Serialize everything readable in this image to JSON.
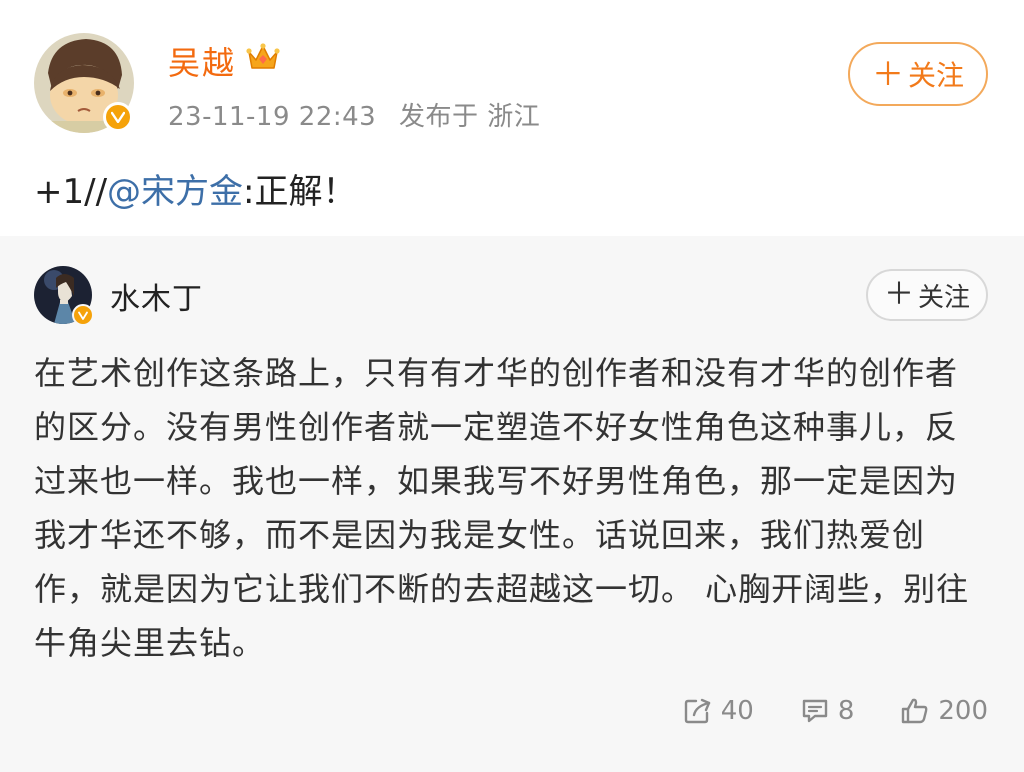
{
  "post": {
    "author": "吴越",
    "timestamp": "23-11-19 22:43",
    "location": "发布于 浙江",
    "follow_label": "关注",
    "text_prefix": "+1//",
    "mention": "@宋方金",
    "text_suffix": ":正解！",
    "icons": {
      "crown": "crown-icon",
      "verified": "verified-badge-icon",
      "plus": "plus-icon"
    },
    "colors": {
      "author": "#f36a0f",
      "follow": "#f27a1a",
      "mention": "#3d6fa8"
    }
  },
  "repost": {
    "author": "水木丁",
    "follow_label": "关注",
    "paragraph": "在艺术创作这条路上，只有有才华的创作者和没有才华的创作者的区分。没有男性创作者就一定塑造不好女性角色这种事儿，反过来也一样。我也一样，如果我写不好男性角色，那一定是因为我才华还不够，而不是因为我是女性。话说回来，我们热爱创作，就是因为它让我们不断的去超越这一切。 心胸开阔些，别往牛角尖里去钻。",
    "actions": {
      "share_count": "40",
      "comment_count": "8",
      "like_count": "200"
    },
    "icons": {
      "share": "share-icon",
      "comment": "comment-icon",
      "like": "thumbs-up-icon"
    }
  }
}
